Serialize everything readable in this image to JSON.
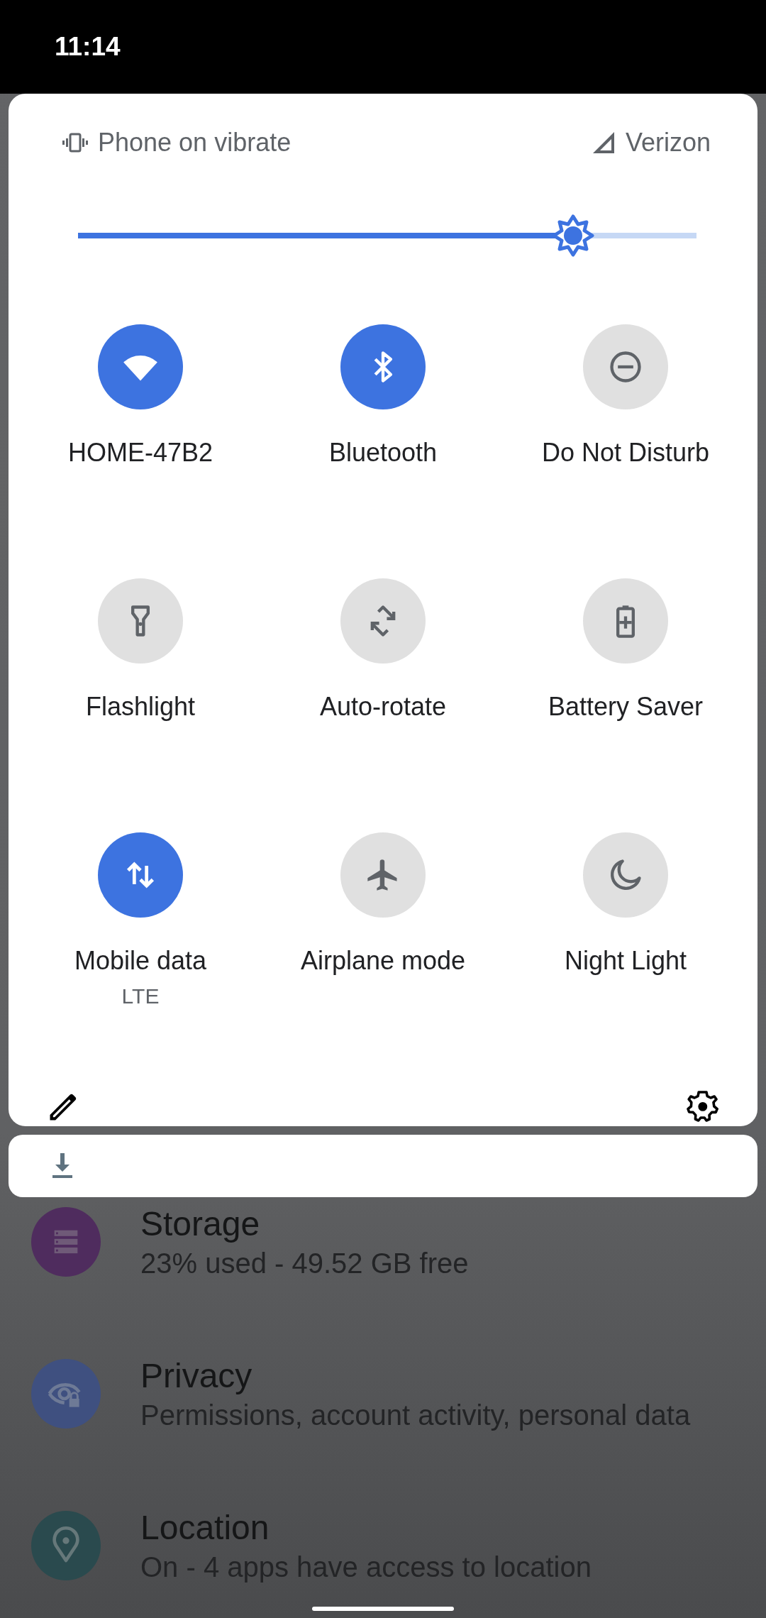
{
  "status_bar": {
    "time": "11:14"
  },
  "quick_settings": {
    "ringer": "Phone on vibrate",
    "carrier": "Verizon",
    "brightness": {
      "level": 0.8
    },
    "tiles": [
      {
        "label": "HOME-47B2",
        "selected": true
      },
      {
        "label": "Bluetooth",
        "selected": true
      },
      {
        "label": "Do Not Disturb",
        "selected": false
      },
      {
        "label": "Flashlight",
        "selected": false
      },
      {
        "label": "Auto-rotate",
        "selected": false
      },
      {
        "label": "Battery Saver",
        "selected": false
      },
      {
        "label": "Mobile data",
        "selected": true,
        "sublabel": "LTE"
      },
      {
        "label": "Airplane mode",
        "selected": false
      },
      {
        "label": "Night Light",
        "selected": false
      }
    ]
  },
  "settings_list": [
    {
      "title": "Storage",
      "subtitle": "23% used - 49.52 GB free",
      "color": "#4f2c5e"
    },
    {
      "title": "Privacy",
      "subtitle": "Permissions, account activity, personal data",
      "color": "#3f5080"
    },
    {
      "title": "Location",
      "subtitle": "On - 4 apps have access to location",
      "color": "#2a4a4e"
    }
  ]
}
